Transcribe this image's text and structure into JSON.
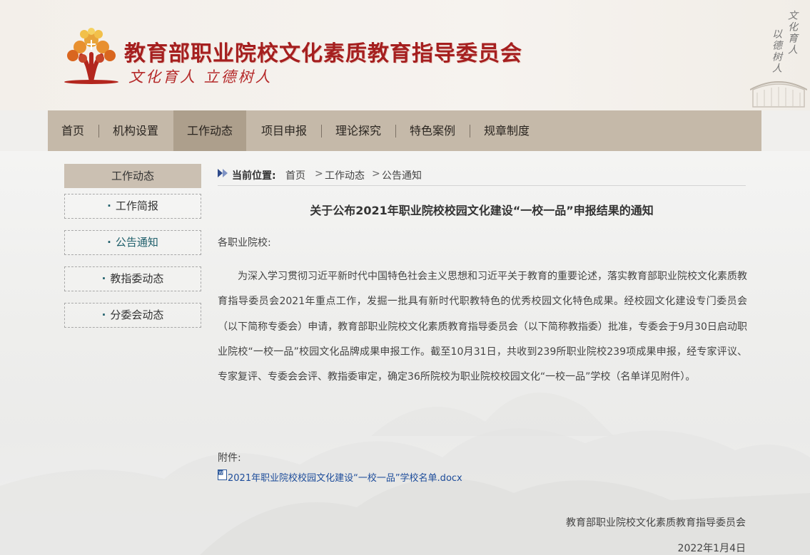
{
  "header": {
    "site_title": "教育部职业院校文化素质教育指导委员会",
    "slogan": "文化育人  立德树人",
    "calligraphy_col1": "文化育人",
    "calligraphy_col2": "以德树人"
  },
  "nav": {
    "items": [
      {
        "label": "首页"
      },
      {
        "label": "机构设置"
      },
      {
        "label": "工作动态",
        "active": true
      },
      {
        "label": "项目申报"
      },
      {
        "label": "理论探究"
      },
      {
        "label": "特色案例"
      },
      {
        "label": "规章制度"
      }
    ]
  },
  "sidebar": {
    "heading": "工作动态",
    "items": [
      {
        "label": "工作简报"
      },
      {
        "label": "公告通知",
        "current": true
      },
      {
        "label": "教指委动态"
      },
      {
        "label": "分委会动态"
      }
    ]
  },
  "breadcrumb": {
    "label": "当前位置:",
    "items": [
      "首页",
      "工作动态",
      "公告通知"
    ],
    "separator": ">"
  },
  "article": {
    "title": "关于公布2021年职业院校校园文化建设“一校一品”申报结果的通知",
    "greeting": "各职业院校:",
    "body": "为深入学习贯彻习近平新时代中国特色社会主义思想和习近平关于教育的重要论述，落实教育部职业院校文化素质教育指导委员会2021年重点工作，发掘一批具有新时代职教特色的优秀校园文化特色成果。经校园文化建设专门委员会（以下简称专委会）申请，教育部职业院校文化素质教育指导委员会（以下简称教指委）批准，专委会于9月30日启动职业院校“一校一品”校园文化品牌成果申报工作。截至10月31日，共收到239所职业院校239项成果申报，经专家评议、专家复评、专委会会评、教指委审定，确定36所院校为职业院校校园文化“一校一品”学校（名单详见附件）。",
    "attachment_label": "附件:",
    "attachment_file": "2021年职业院校校园文化建设“一校一品”学校名单.docx",
    "signer": "教育部职业院校文化素质教育指导委员会",
    "date": "2022年1月4日"
  },
  "colors": {
    "brand_red": "#a51f1f",
    "nav_bg": "#c5b9a9",
    "nav_active": "#ad9f8c",
    "link_blue": "#1d4c9a",
    "sidebar_current": "#1f5f6b"
  }
}
